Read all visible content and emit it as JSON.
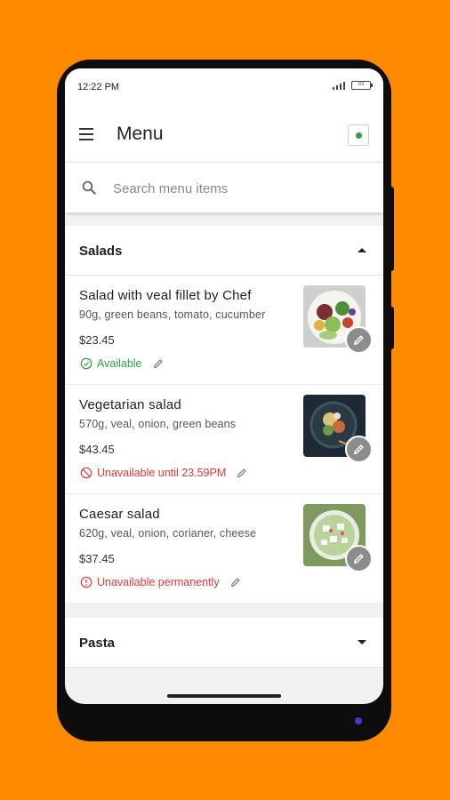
{
  "status_bar": {
    "time": "12:22 PM",
    "battery": "33"
  },
  "app_bar": {
    "title": "Menu",
    "online_color": "#2e9e47"
  },
  "search": {
    "placeholder": "Search menu items",
    "value": ""
  },
  "categories": [
    {
      "title": "Salads",
      "expanded": true,
      "items": [
        {
          "name": "Salad with veal fillet by Chef",
          "description": "90g, green beans, tomato, cucumber",
          "price": "$23.45",
          "status": "Available",
          "status_type": "available",
          "image": "salad-photo"
        },
        {
          "name": "Vegetarian salad",
          "description": "570g, veal, onion, green beans",
          "price": "$43.45",
          "status": "Unavailable until 23.59PM",
          "status_type": "unavailable-until",
          "image": "salad-bowl-photo"
        },
        {
          "name": "Caesar salad",
          "description": "620g, veal, onion, corianer, cheese",
          "price": "$37.45",
          "status": "Unavailable permanently",
          "status_type": "unavailable-permanent",
          "image": "caesar-salad-photo"
        }
      ]
    },
    {
      "title": "Pasta",
      "expanded": false,
      "items": []
    }
  ],
  "colors": {
    "available": "#2e9e47",
    "unavailable": "#e53935",
    "background": "#FF8A00"
  },
  "icons": {
    "menu": "hamburger-icon",
    "search": "search-icon",
    "edit": "pencil-icon",
    "collapse": "caret-up-icon",
    "expand": "caret-down-icon"
  }
}
